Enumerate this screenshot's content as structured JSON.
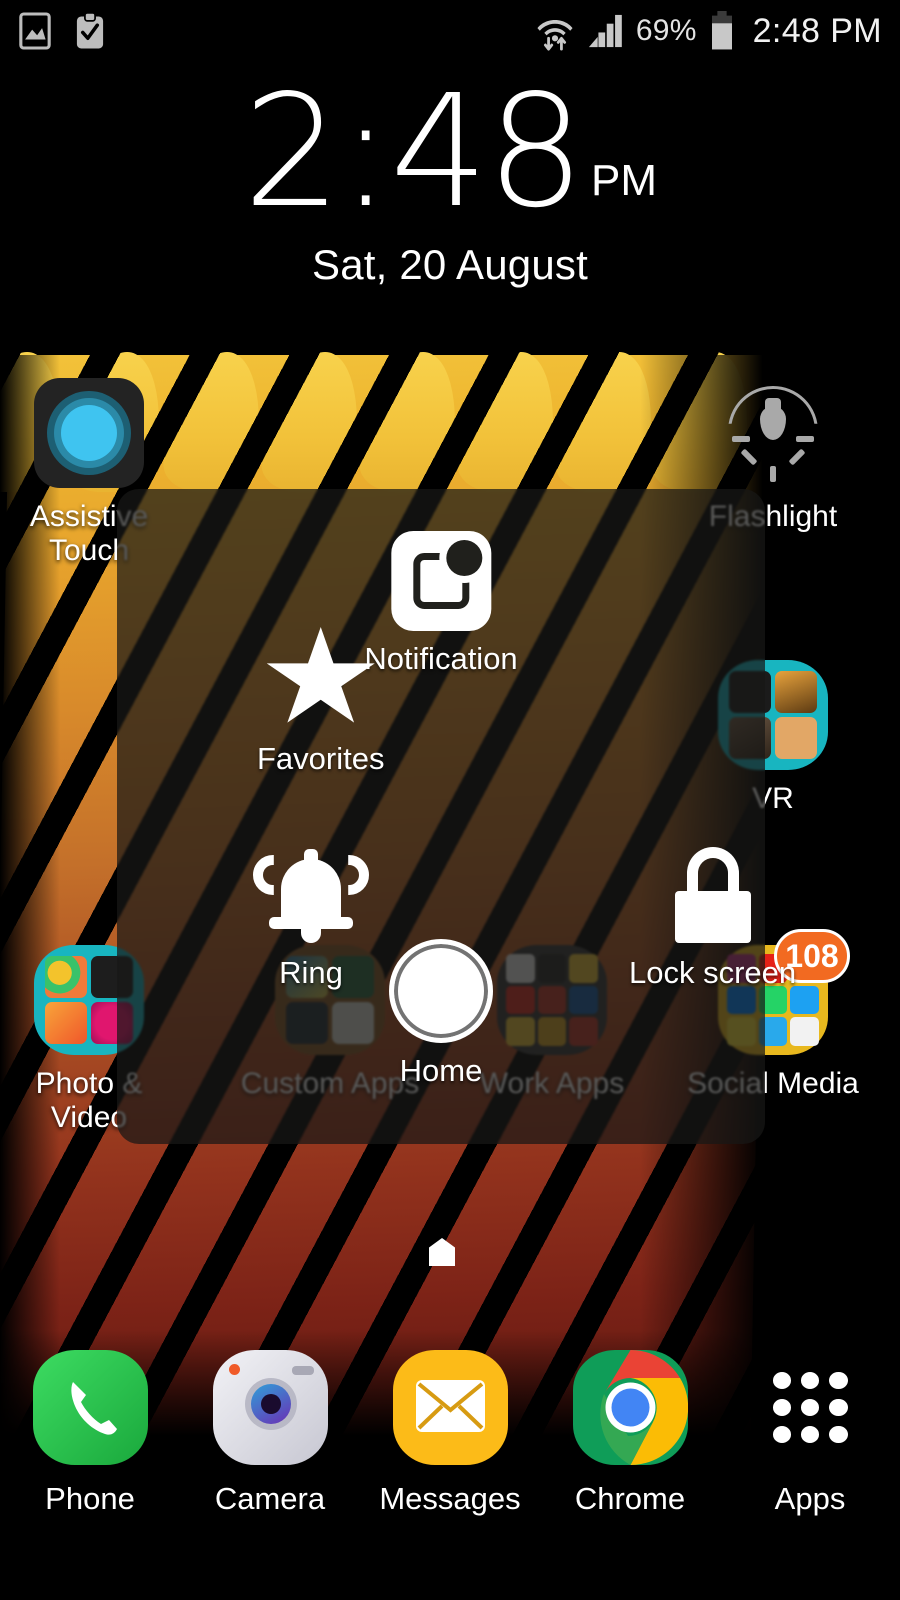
{
  "status_bar": {
    "left_icons": [
      "screenshot-icon",
      "clipboard-check-icon"
    ],
    "wifi_icon": "wifi-data-icon",
    "signal_icon": "signal-bars-icon",
    "battery_percent": "69%",
    "battery_icon": "battery-icon",
    "clock": "2:48 PM"
  },
  "clock_widget": {
    "time": "2:48",
    "ampm": "PM",
    "date": "Sat, 20 August"
  },
  "home_screen": {
    "apps": [
      {
        "label": "Assistive\nTouch",
        "icon": "assistive-touch-icon",
        "name": "app-assistive-touch"
      },
      {
        "label": "Flashlight",
        "icon": "flashlight-icon",
        "name": "app-flashlight"
      },
      {
        "label": "VR",
        "icon": "vr-folder-icon",
        "name": "folder-vr"
      },
      {
        "label": "Photo & Video",
        "icon": "photo-video-folder-icon",
        "name": "folder-photo-video"
      },
      {
        "label": "Custom Apps",
        "icon": "custom-apps-folder-icon",
        "name": "folder-custom-apps"
      },
      {
        "label": "Work Apps",
        "icon": "work-apps-folder-icon",
        "name": "folder-work-apps"
      },
      {
        "label": "Social Media",
        "icon": "social-media-folder-icon",
        "name": "folder-social-media",
        "badge": "108"
      }
    ],
    "page_indicator": "home-page-icon"
  },
  "assistive_touch_menu": {
    "items": [
      {
        "label": "Notification",
        "icon": "notification-icon",
        "name": "at-notification"
      },
      {
        "label": "Favorites",
        "icon": "star-icon",
        "name": "at-favorites"
      },
      {
        "label": "Ring",
        "icon": "bell-icon",
        "name": "at-ring"
      },
      {
        "label": "Lock screen",
        "icon": "lock-icon",
        "name": "at-lock-screen"
      },
      {
        "label": "Home",
        "icon": "home-circle-icon",
        "name": "at-home"
      }
    ]
  },
  "dock": {
    "items": [
      {
        "label": "Phone",
        "icon": "phone-icon",
        "color": "#2ecc40"
      },
      {
        "label": "Camera",
        "icon": "camera-icon",
        "color": "#d8d8e0"
      },
      {
        "label": "Messages",
        "icon": "messages-icon",
        "color": "#fcbb18"
      },
      {
        "label": "Chrome",
        "icon": "chrome-icon",
        "color": "#4285f4"
      },
      {
        "label": "Apps",
        "icon": "apps-grid-icon",
        "color": "#ffffff"
      }
    ]
  },
  "colors": {
    "badge": "#f26a21",
    "accent_blue": "#3fc4f0",
    "folder_teal": "#18b5c0",
    "folder_yellow": "#e8b81e",
    "overlay_scrim": "rgba(24,24,22,0.72)"
  }
}
